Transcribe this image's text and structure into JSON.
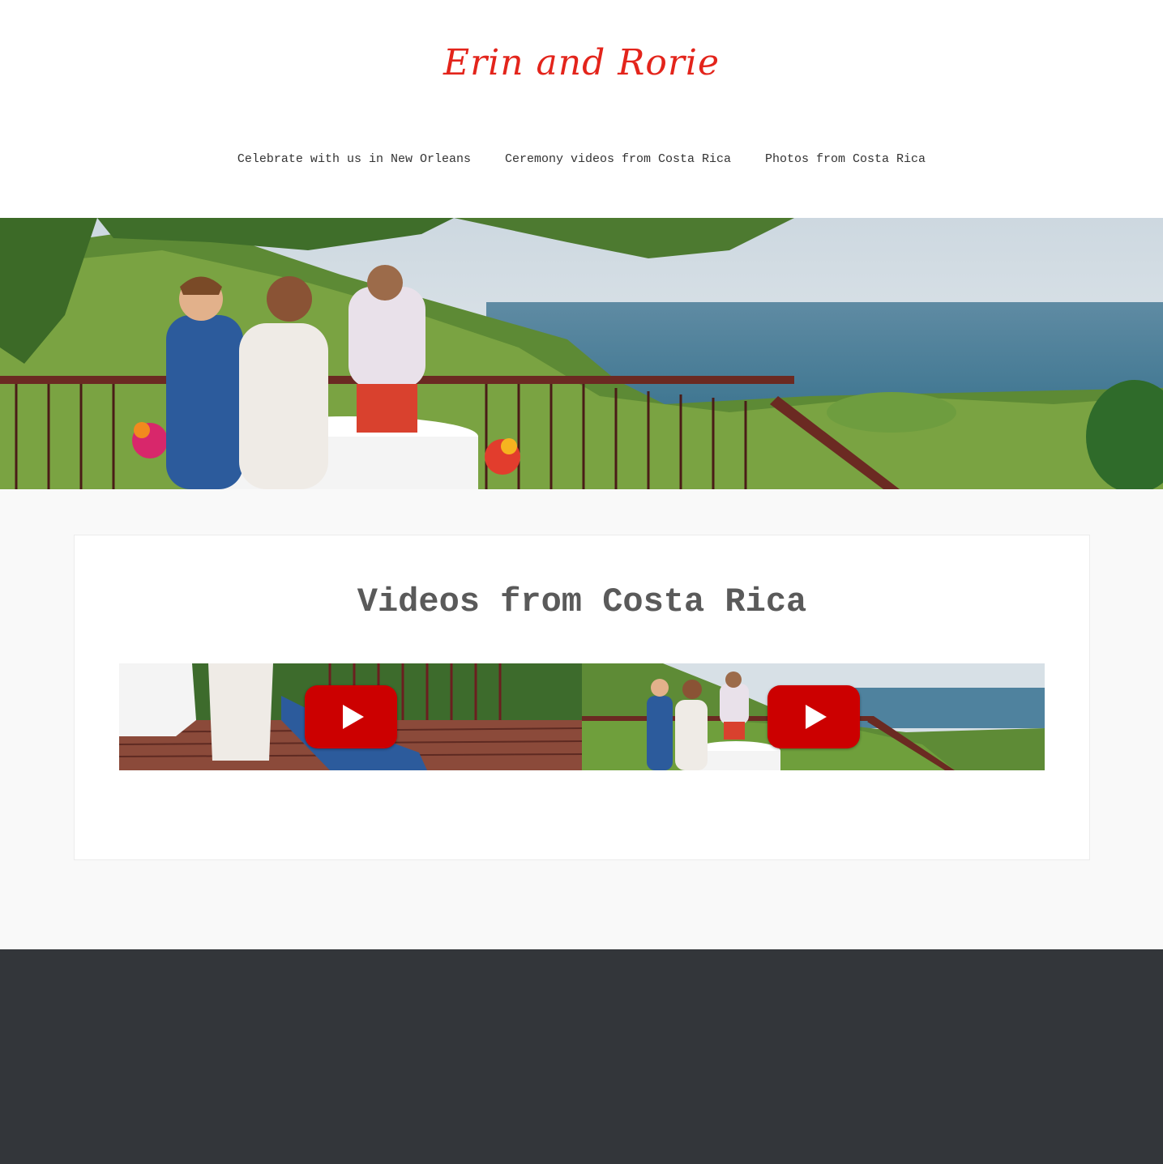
{
  "header": {
    "site_title": "Erin and Rorie",
    "title_color": "#e3241b",
    "nav": [
      {
        "label": "Celebrate with us in New Orleans"
      },
      {
        "label": "Ceremony videos from Costa Rica"
      },
      {
        "label": "Photos from Costa Rica"
      }
    ]
  },
  "main": {
    "heading": "Videos from Costa Rica",
    "videos": [
      {
        "icon": "youtube-play-icon"
      },
      {
        "icon": "youtube-play-icon"
      }
    ]
  },
  "colors": {
    "page_bg": "#f9f9f9",
    "footer_bg": "#33363a",
    "play_button": "#cc0000"
  }
}
